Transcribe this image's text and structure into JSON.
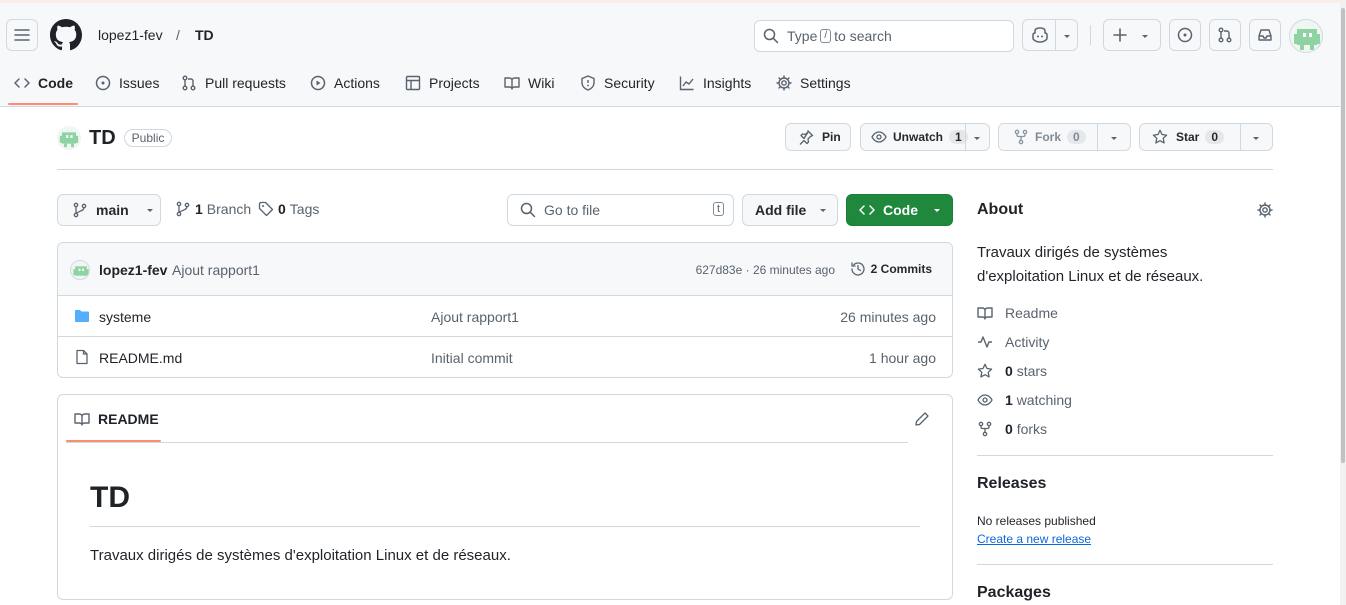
{
  "colors": {
    "accent": "#fd8c73",
    "green": "#1f883d",
    "link": "#0969da",
    "folder": "#54aeff"
  },
  "header": {
    "owner": "lopez1-fev",
    "separator": "/",
    "repo": "TD"
  },
  "search": {
    "type_text": "Type",
    "key": "/",
    "suffix": "to search"
  },
  "tabs": [
    {
      "label": "Code",
      "icon": "code-icon"
    },
    {
      "label": "Issues",
      "icon": "issue-icon"
    },
    {
      "label": "Pull requests",
      "icon": "pull-request-icon"
    },
    {
      "label": "Actions",
      "icon": "play-icon"
    },
    {
      "label": "Projects",
      "icon": "table-icon"
    },
    {
      "label": "Wiki",
      "icon": "book-icon"
    },
    {
      "label": "Security",
      "icon": "shield-icon"
    },
    {
      "label": "Insights",
      "icon": "graph-icon"
    },
    {
      "label": "Settings",
      "icon": "gear-icon"
    }
  ],
  "repo": {
    "name": "TD",
    "visibility": "Public",
    "pin": "Pin",
    "unwatch": "Unwatch",
    "watch_count": "1",
    "fork": "Fork",
    "fork_count": "0",
    "star": "Star",
    "star_count": "0"
  },
  "toolbar": {
    "branch": "main",
    "branches_count": "1",
    "branches_label": "Branch",
    "tags_count": "0",
    "tags_label": "Tags",
    "goto_placeholder": "Go to file",
    "goto_key": "t",
    "add_file": "Add file",
    "code": "Code"
  },
  "commit": {
    "author": "lopez1-fev",
    "message": "Ajout rapport1",
    "sha_time": "627d83e · 26 minutes ago",
    "commits": "2 Commits"
  },
  "files": [
    {
      "name": "systeme",
      "type": "folder",
      "message": "Ajout rapport1",
      "time": "26 minutes ago"
    },
    {
      "name": "README.md",
      "type": "file",
      "message": "Initial commit",
      "time": "1 hour ago"
    }
  ],
  "readme": {
    "tab": "README",
    "heading": "TD",
    "body": "Travaux dirigés de systèmes d'exploitation Linux et de réseaux."
  },
  "about": {
    "title": "About",
    "description_line1": "Travaux dirigés de systèmes",
    "description_line2": "d'exploitation Linux et de réseaux.",
    "readme": "Readme",
    "activity": "Activity",
    "stars_count": "0",
    "stars_label": "stars",
    "watching_count": "1",
    "watching_label": "watching",
    "forks_count": "0",
    "forks_label": "forks"
  },
  "releases": {
    "title": "Releases",
    "none": "No releases published",
    "create": "Create a new release"
  },
  "packages": {
    "title": "Packages"
  }
}
